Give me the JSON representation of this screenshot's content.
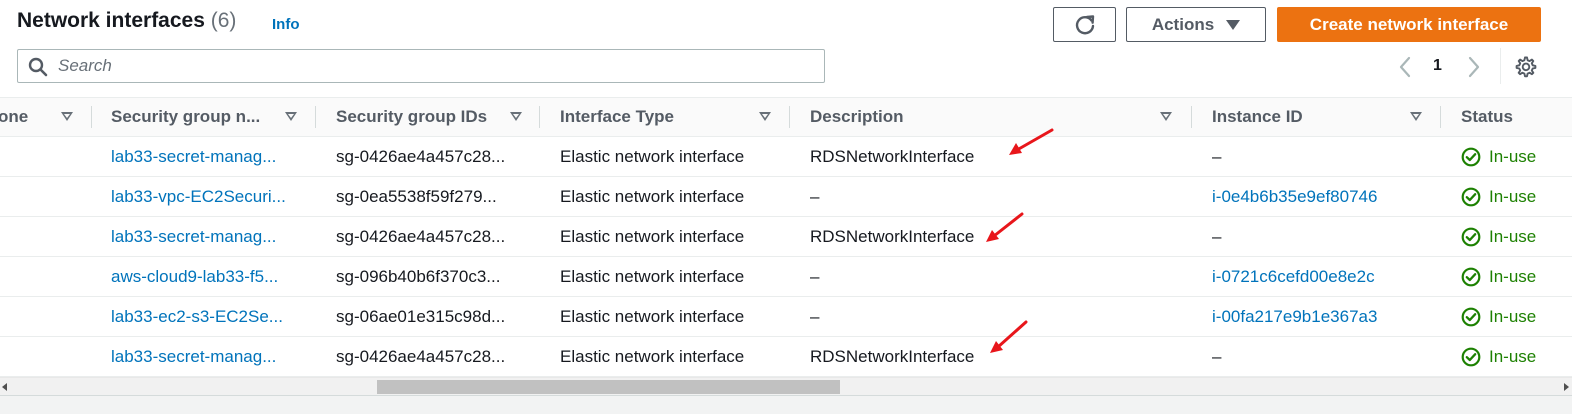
{
  "header": {
    "title": "Network interfaces",
    "count": "(6)",
    "info_label": "Info",
    "refresh_icon": "refresh-icon",
    "actions_label": "Actions",
    "create_label": "Create network interface"
  },
  "search": {
    "placeholder": "Search",
    "value": ""
  },
  "pagination": {
    "current_page": "1"
  },
  "colors": {
    "accent": "#ec7211",
    "link": "#0073bb",
    "success": "#1d8102",
    "annotation_arrow": "#e8161b"
  },
  "table": {
    "columns": [
      "one",
      "Security group n...",
      "Security group IDs",
      "Interface Type",
      "Description",
      "Instance ID",
      "Status"
    ],
    "rows": [
      {
        "sg_name": "lab33-secret-manag...",
        "sg_ids": "sg-0426ae4a457c28...",
        "type": "Elastic network interface",
        "description": "RDSNetworkInterface",
        "instance_id": "–",
        "status": "In-use"
      },
      {
        "sg_name": "lab33-vpc-EC2Securi...",
        "sg_ids": "sg-0ea5538f59f279...",
        "type": "Elastic network interface",
        "description": "–",
        "instance_id": "i-0e4b6b35e9ef80746",
        "status": "In-use"
      },
      {
        "sg_name": "lab33-secret-manag...",
        "sg_ids": "sg-0426ae4a457c28...",
        "type": "Elastic network interface",
        "description": "RDSNetworkInterface",
        "instance_id": "–",
        "status": "In-use"
      },
      {
        "sg_name": "aws-cloud9-lab33-f5...",
        "sg_ids": "sg-096b40b6f370c3...",
        "type": "Elastic network interface",
        "description": "–",
        "instance_id": "i-0721c6cefd00e8e2c",
        "status": "In-use"
      },
      {
        "sg_name": "lab33-ec2-s3-EC2Se...",
        "sg_ids": "sg-06ae01e315c98d...",
        "type": "Elastic network interface",
        "description": "–",
        "instance_id": "i-00fa217e9b1e367a3",
        "status": "In-use"
      },
      {
        "sg_name": "lab33-secret-manag...",
        "sg_ids": "sg-0426ae4a457c28...",
        "type": "Elastic network interface",
        "description": "RDSNetworkInterface",
        "instance_id": "–",
        "status": "In-use"
      }
    ]
  }
}
